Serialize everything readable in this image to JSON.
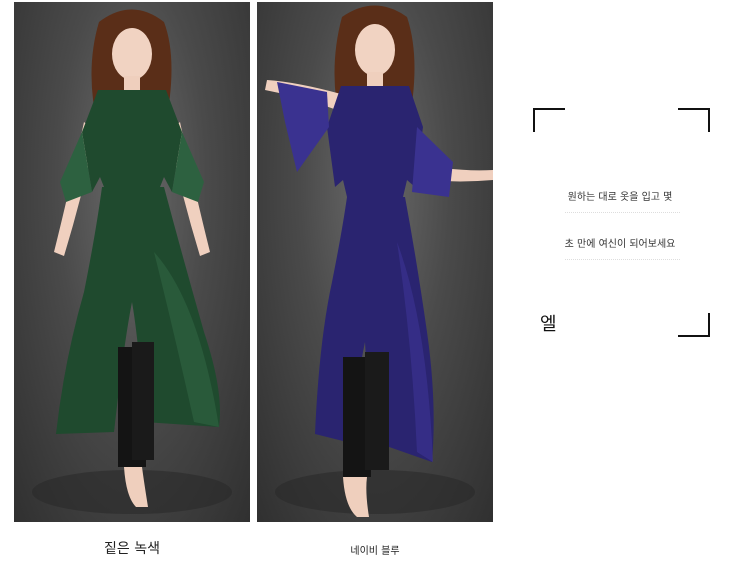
{
  "products": [
    {
      "color_name": "짙은 녹색",
      "image": {
        "dress_color": "#1f4a2e",
        "dress_highlight": "#2d6140",
        "background_color": "#4a4a4a"
      }
    },
    {
      "color_name": "네이비 블루",
      "image": {
        "dress_color": "#2a2470",
        "dress_highlight": "#3a3290",
        "background_color": "#4a4a4a"
      }
    }
  ],
  "promo": {
    "line1": "원하는 대로 옷을 입고 몇",
    "line2": "초 만에 여신이 되어보세요",
    "brand": "엘"
  }
}
